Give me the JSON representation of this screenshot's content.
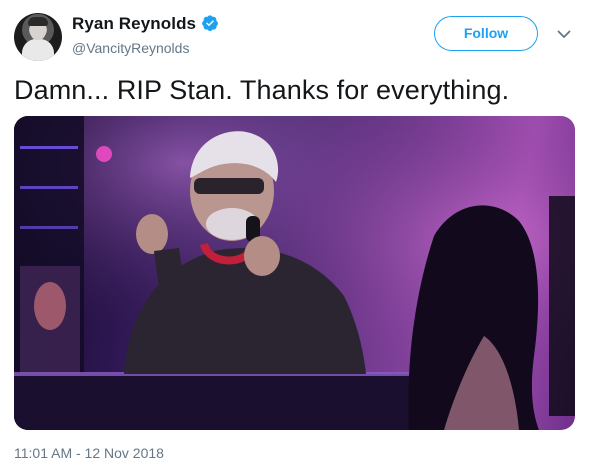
{
  "colors": {
    "accent": "#1da1f2",
    "text_primary": "#14171a",
    "text_secondary": "#657786"
  },
  "author": {
    "display_name": "Ryan Reynolds",
    "handle": "@VancityReynolds",
    "verified": true,
    "avatar_icon": "user-avatar"
  },
  "actions": {
    "follow_label": "Follow",
    "more_icon": "chevron-down-icon"
  },
  "tweet": {
    "text": "Damn... RIP Stan. Thanks for everything.",
    "media_icon": "photo",
    "timestamp": "11:01 AM - 12 Nov 2018"
  }
}
